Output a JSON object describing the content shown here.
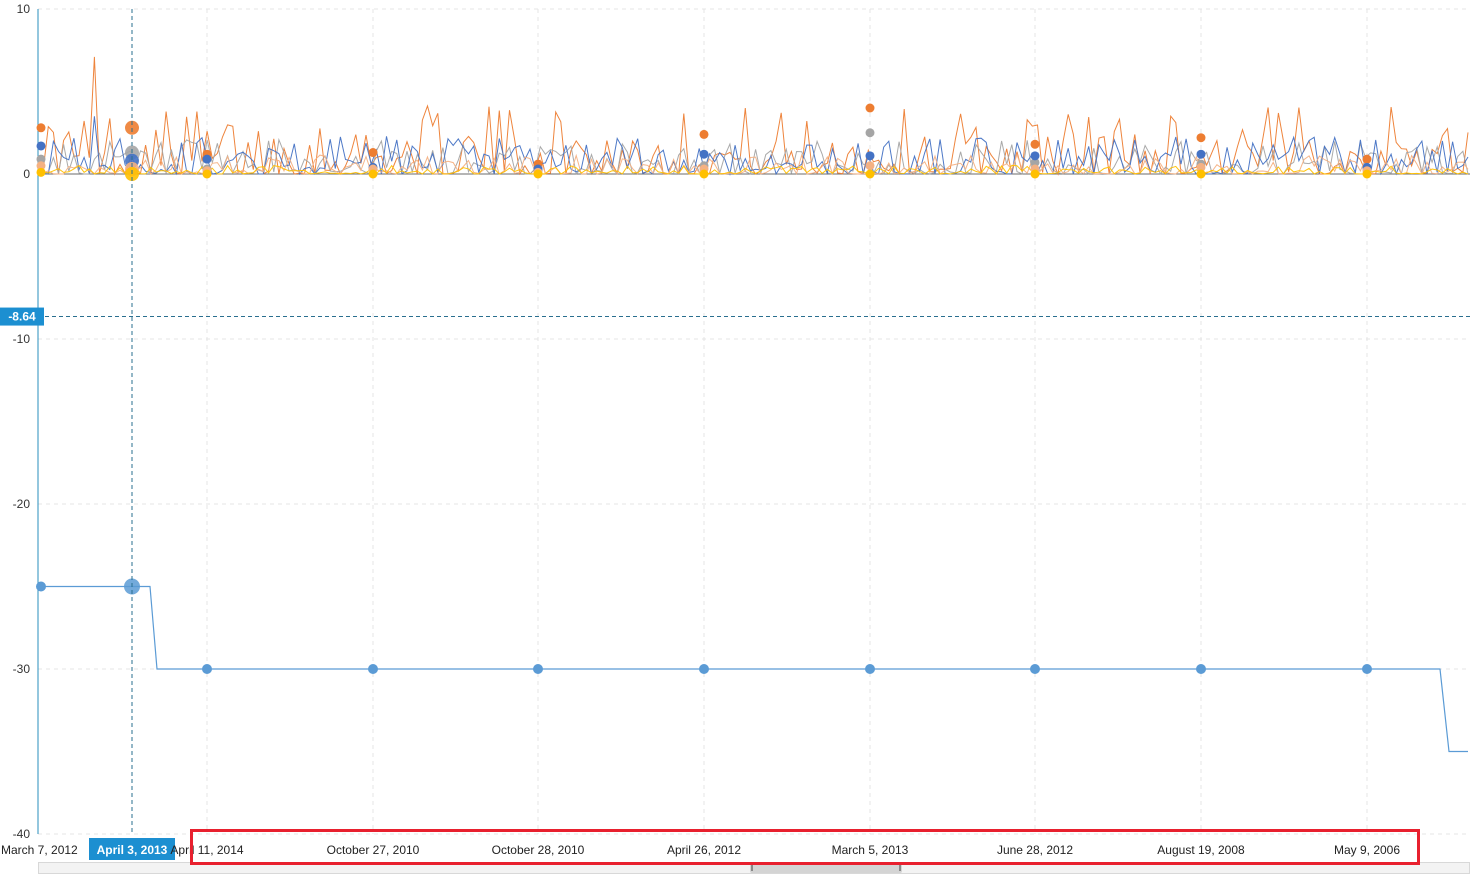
{
  "chart_data": {
    "type": "line",
    "title": "",
    "xlabel": "",
    "ylabel": "",
    "ylim": [
      -40,
      10
    ],
    "y_ticks": [
      10,
      0,
      -10,
      -20,
      -30,
      -40
    ],
    "grid": true,
    "x_tick_labels": [
      "March 7, 2012",
      "April 11, 2014",
      "October 27, 2010",
      "October 28, 2010",
      "April 26, 2012",
      "March 5, 2013",
      "June 28, 2012",
      "August 19, 2008",
      "May 9, 2006"
    ],
    "crosshair": {
      "x_label": "April 3, 2013",
      "y_label": "-8.64",
      "y_value": -8.64
    },
    "step_series": {
      "color": "#5b9bd5",
      "values": [
        -25,
        -25,
        -30,
        -30,
        -30,
        -30,
        -30,
        -30,
        -30,
        -30,
        -30,
        -35
      ]
    },
    "series": [
      {
        "color": "#ed7d31",
        "marker_values": [
          2.8,
          2.8,
          1.2,
          1.3,
          0.6,
          2.4,
          4.0,
          1.8,
          2.2,
          0.9
        ]
      },
      {
        "color": "#a5a5a5",
        "marker_values": [
          0.9,
          1.3,
          0.3,
          0.3,
          0.2,
          0.5,
          2.5,
          0.7,
          0.6,
          0.3
        ]
      },
      {
        "color": "#4472c4",
        "marker_values": [
          1.7,
          0.8,
          0.9,
          0.4,
          0.3,
          1.2,
          1.1,
          1.1,
          1.2,
          0.4
        ]
      },
      {
        "color": "#f4b183",
        "marker_values": [
          0.5,
          0.3,
          0.2,
          0.3,
          0.1,
          0.3,
          0.5,
          0.3,
          0.4,
          0.2
        ]
      },
      {
        "color": "#ffc000",
        "marker_values": [
          0.1,
          0.0,
          0.0,
          0.0,
          0.0,
          0.0,
          0.0,
          0.0,
          0.0,
          0.0
        ]
      }
    ]
  }
}
